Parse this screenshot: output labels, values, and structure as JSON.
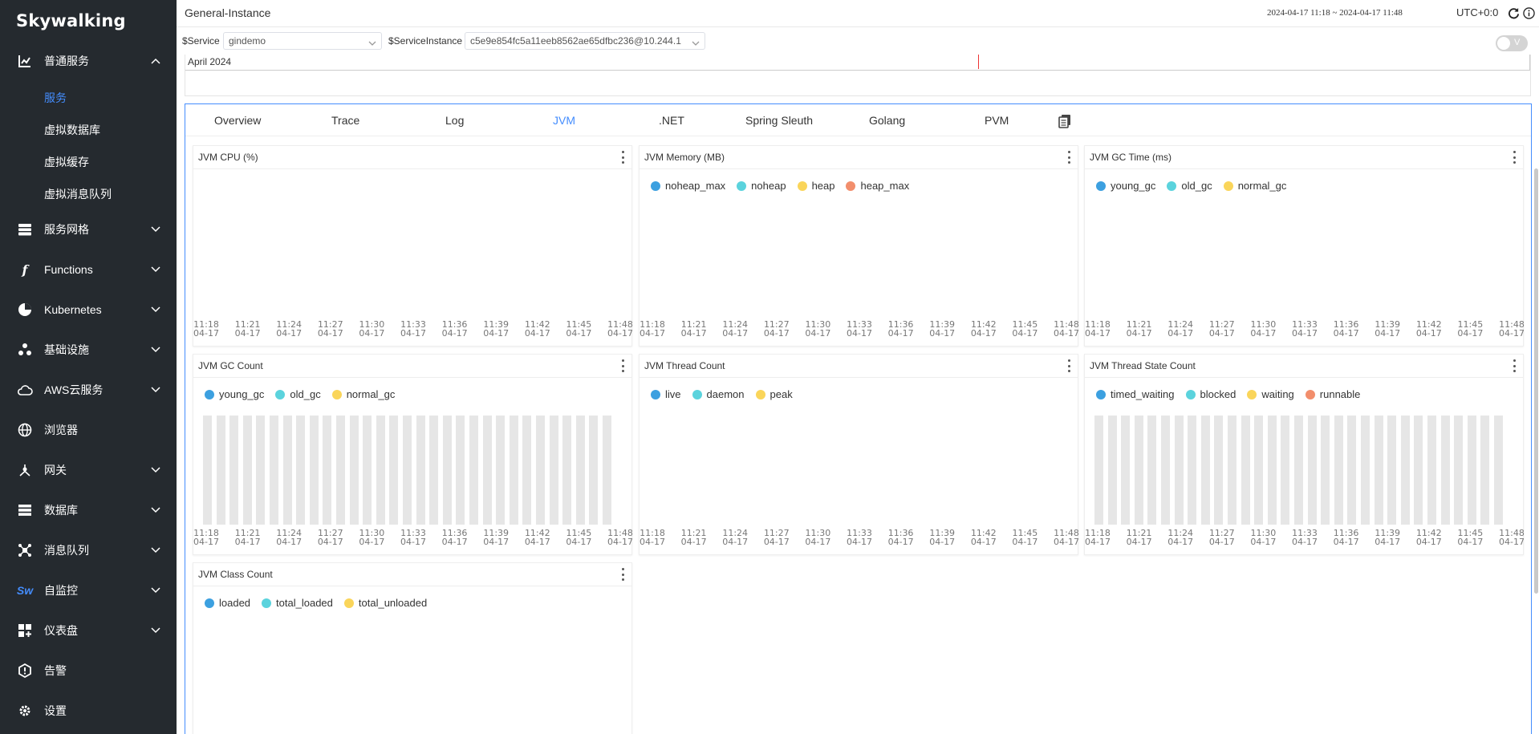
{
  "brand": {
    "name": "Skywalking"
  },
  "sidebar": {
    "items": [
      {
        "label": "普通服务",
        "icon": "chart-icon",
        "expanded": true
      },
      {
        "label": "服务网格",
        "icon": "layers-icon"
      },
      {
        "label": "Functions",
        "icon": "function-icon"
      },
      {
        "label": "Kubernetes",
        "icon": "pie-icon"
      },
      {
        "label": "基础设施",
        "icon": "nodes-icon"
      },
      {
        "label": "AWS云服务",
        "icon": "cloud-icon"
      },
      {
        "label": "浏览器",
        "icon": "globe-icon"
      },
      {
        "label": "网关",
        "icon": "gateway-icon"
      },
      {
        "label": "数据库",
        "icon": "database-icon"
      },
      {
        "label": "消息队列",
        "icon": "queue-icon"
      },
      {
        "label": "自监控",
        "icon": "sw-icon"
      },
      {
        "label": "仪表盘",
        "icon": "dashboard-icon"
      },
      {
        "label": "告警",
        "icon": "alert-icon"
      },
      {
        "label": "设置",
        "icon": "gear-icon"
      }
    ],
    "subitems": [
      {
        "label": "服务",
        "active": true
      },
      {
        "label": "虚拟数据库"
      },
      {
        "label": "虚拟缓存"
      },
      {
        "label": "虚拟消息队列"
      }
    ]
  },
  "header": {
    "title": "General-Instance",
    "time_range": "2024-04-17 11:18 ~ 2024-04-17 11:48",
    "timezone": "UTC+0:0"
  },
  "selectors": {
    "service_label": "$Service",
    "service_value": "gindemo",
    "instance_label": "$ServiceInstance",
    "instance_value": "c5e9e854fc5a11eeb8562ae65dfbc236@10.244.1",
    "toggle_label": "V"
  },
  "timeline": {
    "label": "April 2024"
  },
  "tabs": [
    {
      "label": "Overview"
    },
    {
      "label": "Trace"
    },
    {
      "label": "Log"
    },
    {
      "label": "JVM",
      "active": true
    },
    {
      "label": ".NET"
    },
    {
      "label": "Spring Sleuth"
    },
    {
      "label": "Golang"
    },
    {
      "label": "PVM"
    }
  ],
  "colors": {
    "accent": "#448dfe",
    "sidebar_bg": "#252a2f",
    "series": [
      "#3ca0e0",
      "#5bd3dd",
      "#fad55a",
      "#f28e6c"
    ]
  },
  "x_axis": {
    "times": [
      "11:18",
      "11:21",
      "11:24",
      "11:27",
      "11:30",
      "11:33",
      "11:36",
      "11:39",
      "11:42",
      "11:45",
      "11:48"
    ],
    "dates": [
      "04-17",
      "04-17",
      "04-17",
      "04-17",
      "04-17",
      "04-17",
      "04-17",
      "04-17",
      "04-17",
      "04-17",
      "04-17"
    ]
  },
  "widgets": [
    {
      "title": "JVM CPU (%)",
      "legend": []
    },
    {
      "title": "JVM Memory (MB)",
      "legend": [
        "noheap_max",
        "noheap",
        "heap",
        "heap_max"
      ]
    },
    {
      "title": "JVM GC Time (ms)",
      "legend": [
        "young_gc",
        "old_gc",
        "normal_gc"
      ]
    },
    {
      "title": "JVM GC Count",
      "legend": [
        "young_gc",
        "old_gc",
        "normal_gc"
      ],
      "bars": 31
    },
    {
      "title": "JVM Thread Count",
      "legend": [
        "live",
        "daemon",
        "peak"
      ]
    },
    {
      "title": "JVM Thread State Count",
      "legend": [
        "timed_waiting",
        "blocked",
        "waiting",
        "runnable"
      ],
      "bars": 31
    },
    {
      "title": "JVM Class Count",
      "legend": [
        "loaded",
        "total_loaded",
        "total_unloaded"
      ]
    }
  ]
}
